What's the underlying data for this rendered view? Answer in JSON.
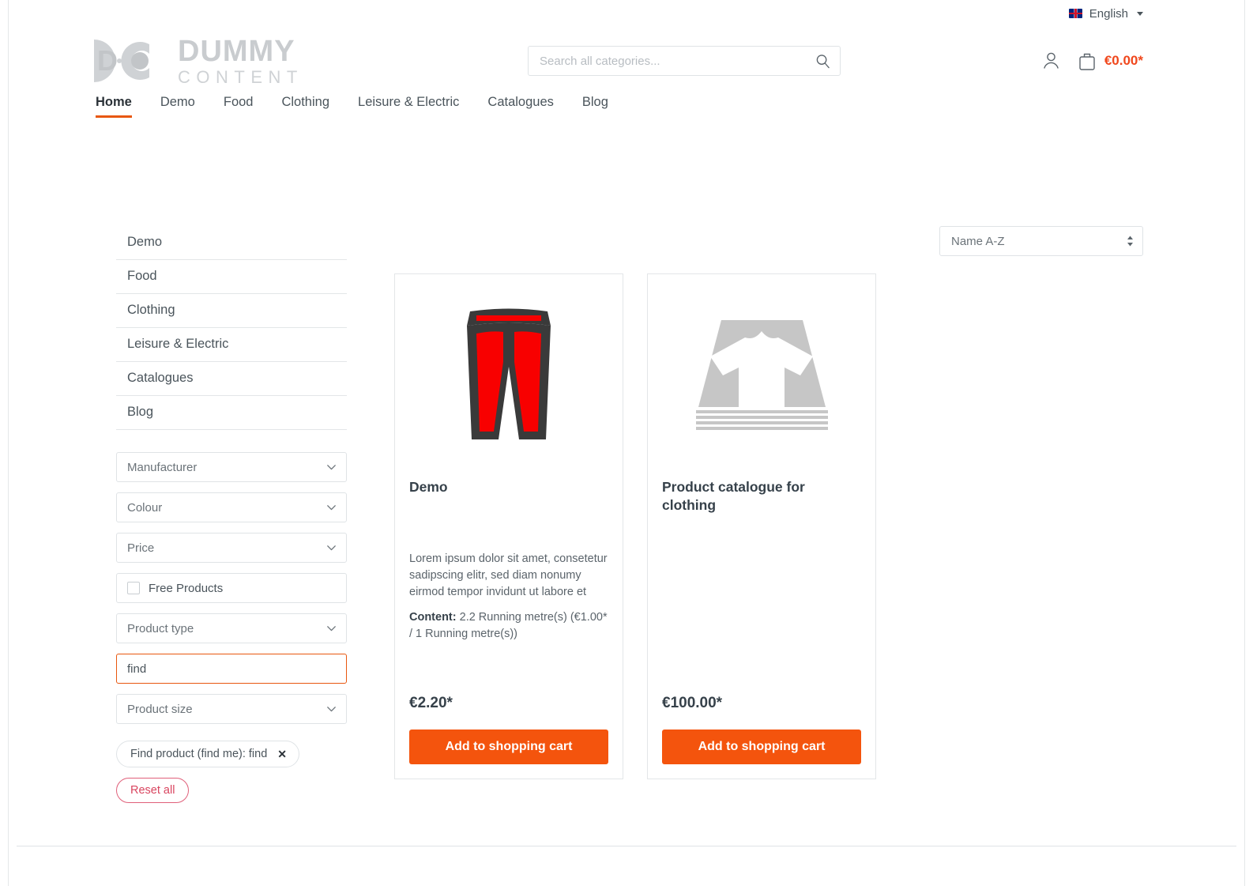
{
  "topbar": {
    "language": "English",
    "flag_icon": "uk-flag-icon",
    "caret_icon": "chevron-down-icon"
  },
  "header": {
    "logo_primary": "DUMMY",
    "logo_secondary": "CONTENT",
    "logo_mark": "dc-logo-icon",
    "search": {
      "placeholder": "Search all categories...",
      "value": "",
      "icon": "search-icon"
    },
    "account_icon": "user-account-icon",
    "cart_icon": "shopping-bag-icon",
    "cart_total": "€0.00*"
  },
  "nav": {
    "items": [
      {
        "label": "Home",
        "active": true
      },
      {
        "label": "Demo",
        "active": false
      },
      {
        "label": "Food",
        "active": false
      },
      {
        "label": "Clothing",
        "active": false
      },
      {
        "label": "Leisure & Electric",
        "active": false
      },
      {
        "label": "Catalogues",
        "active": false
      },
      {
        "label": "Blog",
        "active": false
      }
    ]
  },
  "sidebar": {
    "categories": [
      {
        "label": "Demo"
      },
      {
        "label": "Food"
      },
      {
        "label": "Clothing"
      },
      {
        "label": "Leisure & Electric"
      },
      {
        "label": "Catalogues"
      },
      {
        "label": "Blog"
      }
    ],
    "filters": [
      {
        "label": "Manufacturer",
        "type": "dropdown",
        "focused": false
      },
      {
        "label": "Colour",
        "type": "dropdown",
        "focused": false
      },
      {
        "label": "Price",
        "type": "dropdown",
        "focused": false
      },
      {
        "label": "Free Products",
        "type": "checkbox",
        "checked": false
      },
      {
        "label": "Product type",
        "type": "dropdown",
        "focused": false
      },
      {
        "label": "find",
        "type": "text",
        "focused": true,
        "placeholder": "find"
      },
      {
        "label": "Product size",
        "type": "dropdown",
        "focused": false
      }
    ],
    "active_chip": {
      "label": "Find product (find me): find",
      "remove_icon": "close-icon"
    },
    "reset_label": "Reset all"
  },
  "main": {
    "sort": {
      "value": "Name A-Z",
      "icon": "sort-updown-icon"
    },
    "products": [
      {
        "name": "Demo",
        "image_icon": "red-trousers-icon",
        "description": "Lorem ipsum dolor sit amet, consetetur sadipscing elitr, sed diam nonumy eirmod tempor invidunt ut labore et",
        "content_label": "Content:",
        "content_value": "2.2 Running metre(s) (€1.00* / 1 Running metre(s))",
        "price": "€2.20*",
        "buy_label": "Add to shopping cart"
      },
      {
        "name": "Product catalogue for clothing",
        "image_icon": "catalogue-tshirt-icon",
        "description": "",
        "content_label": "",
        "content_value": "",
        "price": "€100.00*",
        "buy_label": "Add to shopping cart"
      }
    ]
  },
  "colors": {
    "accent_orange": "#f4540d",
    "nav_underline": "#e8570f",
    "price_orange": "#f0471c",
    "reset_red": "#d9455f",
    "text_dark": "#36414a",
    "text_body": "#4a545b",
    "border": "#e3e6e8",
    "logo_grey": "#c9cccf",
    "trousers_red": "#f80000",
    "trousers_outline": "#3a3a3a",
    "catalogue_grey": "#c6c6c6"
  }
}
